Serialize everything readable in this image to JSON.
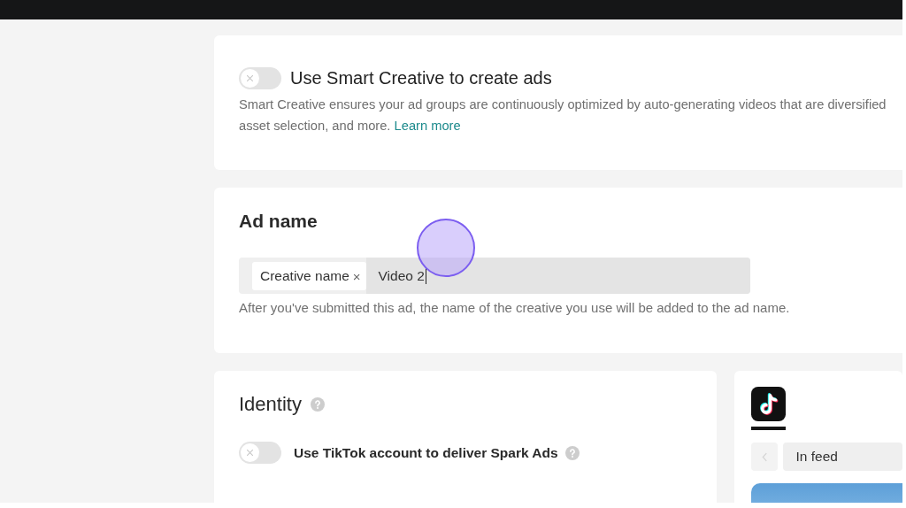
{
  "smart_creative": {
    "on": false,
    "title": "Use Smart Creative to create ads",
    "description_lines": [
      "Smart Creative ensures your ad groups are continuously optimized by auto-generating videos that are diversified",
      "asset selection, and more."
    ],
    "link": "Learn more"
  },
  "ad_name": {
    "title": "Ad name",
    "tags": [
      {
        "label": "Creative name",
        "remove": "×"
      }
    ],
    "value": "Video 2",
    "hint": "After you've submitted this ad, the name of the creative you use will be added to the ad name."
  },
  "identity": {
    "title": "Identity",
    "spark_ads": {
      "on": false,
      "label": "Use TikTok account to deliver Spark Ads"
    }
  },
  "preview": {
    "placements": [
      {
        "selected": true
      }
    ],
    "prev_disabled": true,
    "view": "In feed"
  },
  "click_marker": true
}
